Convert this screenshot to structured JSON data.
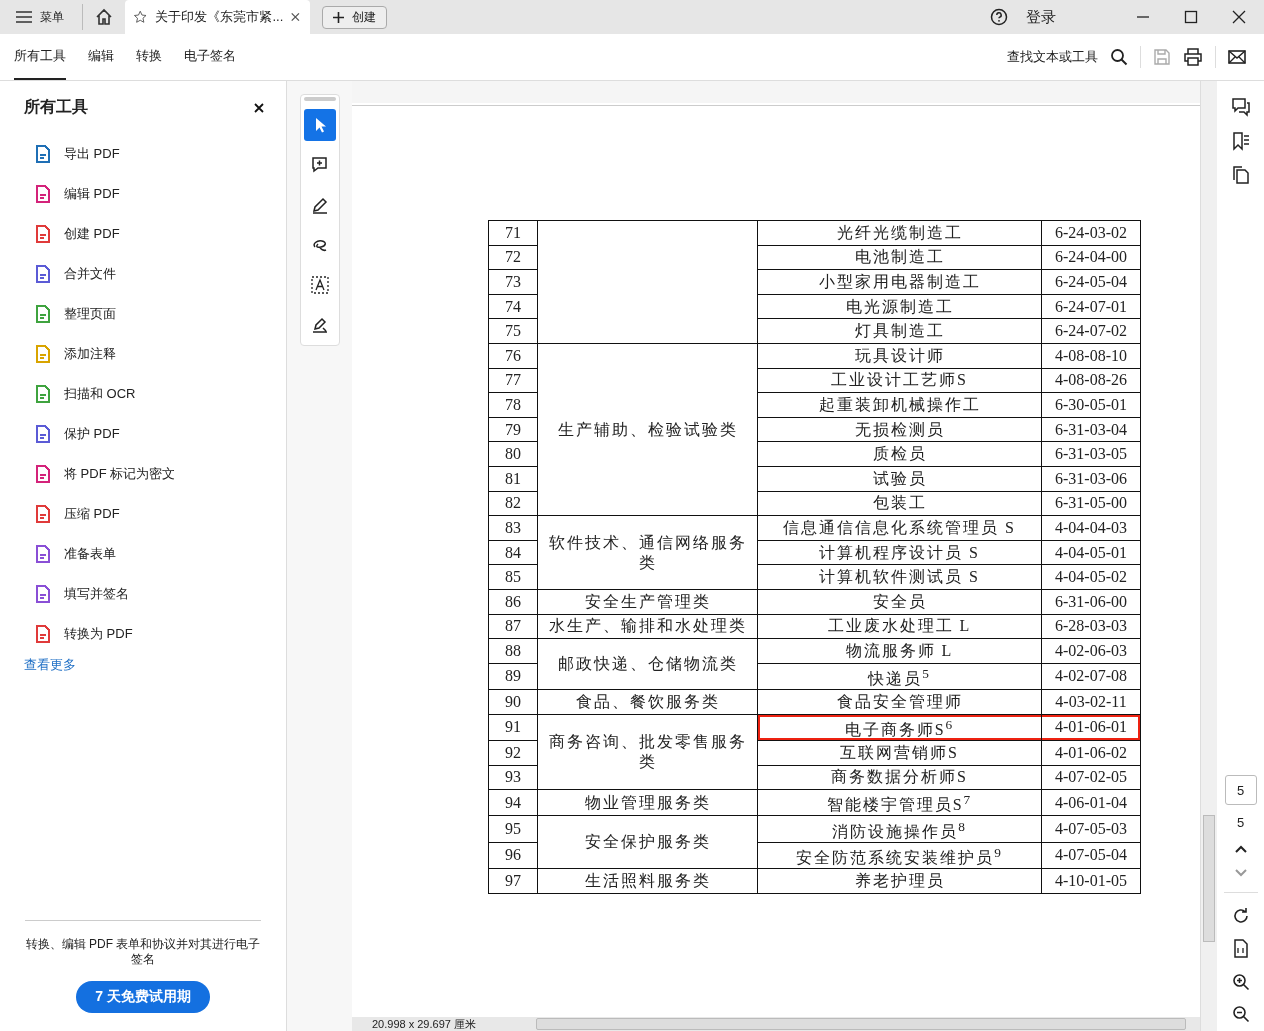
{
  "tabbar": {
    "menu": "菜单",
    "tab_title": "关于印发《东莞市紧...",
    "create": "创建",
    "login": "登录"
  },
  "toolbar": {
    "tabs": [
      {
        "label": "所有工具",
        "selected": true
      },
      {
        "label": "编辑",
        "selected": false
      },
      {
        "label": "转换",
        "selected": false
      },
      {
        "label": "电子签名",
        "selected": false
      }
    ],
    "search": "查找文本或工具"
  },
  "sidebar": {
    "title": "所有工具",
    "items": [
      {
        "label": "导出 PDF",
        "color": "#1f6fb5"
      },
      {
        "label": "编辑 PDF",
        "color": "#d4237a"
      },
      {
        "label": "创建 PDF",
        "color": "#e03a3a"
      },
      {
        "label": "合并文件",
        "color": "#5b5bd6"
      },
      {
        "label": "整理页面",
        "color": "#3fa33f"
      },
      {
        "label": "添加注释",
        "color": "#d9a400"
      },
      {
        "label": "扫描和 OCR",
        "color": "#3fa33f"
      },
      {
        "label": "保护 PDF",
        "color": "#5b5bd6"
      },
      {
        "label": "将 PDF 标记为密文",
        "color": "#d4237a"
      },
      {
        "label": "压缩 PDF",
        "color": "#e03a3a"
      },
      {
        "label": "准备表单",
        "color": "#8a4fd6"
      },
      {
        "label": "填写并签名",
        "color": "#8a4fd6"
      },
      {
        "label": "转换为 PDF",
        "color": "#e03a3a"
      }
    ],
    "more": "查看更多",
    "promo": "转换、编辑 PDF 表单和协议并对其进行电子签名",
    "trial": "7 天免费试用期"
  },
  "tools": [
    {
      "kind": "select",
      "selected": true
    },
    {
      "kind": "comment",
      "selected": false
    },
    {
      "kind": "pen",
      "selected": false
    },
    {
      "kind": "lasso",
      "selected": false
    },
    {
      "kind": "text",
      "selected": false
    },
    {
      "kind": "sign",
      "selected": false
    }
  ],
  "table": {
    "groups": [
      {
        "rows": [
          {
            "num": "71",
            "job": "光纤光缆制造工",
            "code": "6-24-03-02",
            "highlighted": false
          },
          {
            "num": "72",
            "job": "电池制造工",
            "code": "6-24-04-00",
            "highlighted": false
          },
          {
            "num": "73",
            "job": "小型家用电器制造工",
            "code": "6-24-05-04",
            "highlighted": false
          },
          {
            "num": "74",
            "job": "电光源制造工",
            "code": "6-24-07-01",
            "highlighted": false
          },
          {
            "num": "75",
            "job": "灯具制造工",
            "code": "6-24-07-02",
            "highlighted": false
          }
        ]
      },
      {
        "name": "生产辅助、检验试验类",
        "rows": [
          {
            "num": "76",
            "job": "玩具设计师",
            "code": "4-08-08-10",
            "highlighted": false
          },
          {
            "num": "77",
            "job": "工业设计工艺师S",
            "code": "4-08-08-26",
            "highlighted": false
          },
          {
            "num": "78",
            "job": "起重装卸机械操作工",
            "code": "6-30-05-01",
            "highlighted": false
          },
          {
            "num": "79",
            "job": "无损检测员",
            "code": "6-31-03-04",
            "highlighted": false
          },
          {
            "num": "80",
            "job": "质检员",
            "code": "6-31-03-05",
            "highlighted": false
          },
          {
            "num": "81",
            "job": "试验员",
            "code": "6-31-03-06",
            "highlighted": false
          },
          {
            "num": "82",
            "job": "包装工",
            "code": "6-31-05-00",
            "highlighted": false
          }
        ]
      },
      {
        "name": "软件技术、通信网络服务类",
        "rows": [
          {
            "num": "83",
            "job": "信息通信信息化系统管理员 S",
            "code": "4-04-04-03",
            "highlighted": false
          },
          {
            "num": "84",
            "job": "计算机程序设计员 S",
            "code": "4-04-05-01",
            "highlighted": false
          },
          {
            "num": "85",
            "job": "计算机软件测试员 S",
            "code": "4-04-05-02",
            "highlighted": false
          }
        ]
      },
      {
        "name": "安全生产管理类",
        "rows": [
          {
            "num": "86",
            "job": "安全员",
            "code": "6-31-06-00",
            "highlighted": false
          }
        ]
      },
      {
        "name": "水生产、输排和水处理类",
        "rows": [
          {
            "num": "87",
            "job": "工业废水处理工 L",
            "code": "6-28-03-03",
            "highlighted": false
          }
        ]
      },
      {
        "name": "邮政快递、仓储物流类",
        "rows": [
          {
            "num": "88",
            "job": "物流服务师 L",
            "code": "4-02-06-03",
            "highlighted": false
          },
          {
            "num": "89",
            "job": "快递员$^{5}$",
            "code": "4-02-07-08",
            "highlighted": false
          }
        ]
      },
      {
        "name": "食品、餐饮服务类",
        "rows": [
          {
            "num": "90",
            "job": "食品安全管理师",
            "code": "4-03-02-11",
            "highlighted": false
          }
        ]
      },
      {
        "name": "商务咨询、批发零售服务类",
        "rows": [
          {
            "num": "91",
            "job": "电子商务师S$^{6}$",
            "code": "4-01-06-01",
            "highlighted": true
          },
          {
            "num": "92",
            "job": "互联网营销师S",
            "code": "4-01-06-02",
            "highlighted": false
          },
          {
            "num": "93",
            "job": "商务数据分析师S",
            "code": "4-07-02-05",
            "highlighted": false
          }
        ]
      },
      {
        "name": "物业管理服务类",
        "rows": [
          {
            "num": "94",
            "job": "智能楼宇管理员S$^{7}$",
            "code": "4-06-01-04",
            "highlighted": false
          }
        ]
      },
      {
        "name": "安全保护服务类",
        "rows": [
          {
            "num": "95",
            "job": "消防设施操作员$^{8}$",
            "code": "4-07-05-03",
            "highlighted": false
          },
          {
            "num": "96",
            "job": "安全防范系统安装维护员$^{9}$",
            "code": "4-07-05-04",
            "highlighted": false
          }
        ]
      },
      {
        "name": "生活照料服务类",
        "rows": [
          {
            "num": "97",
            "job": "养老护理员",
            "code": "4-10-01-05",
            "highlighted": false
          }
        ]
      }
    ]
  },
  "status": {
    "size": "20.998 x 29.697 厘米"
  },
  "pager": {
    "page_field": "5",
    "page_count": "5"
  }
}
